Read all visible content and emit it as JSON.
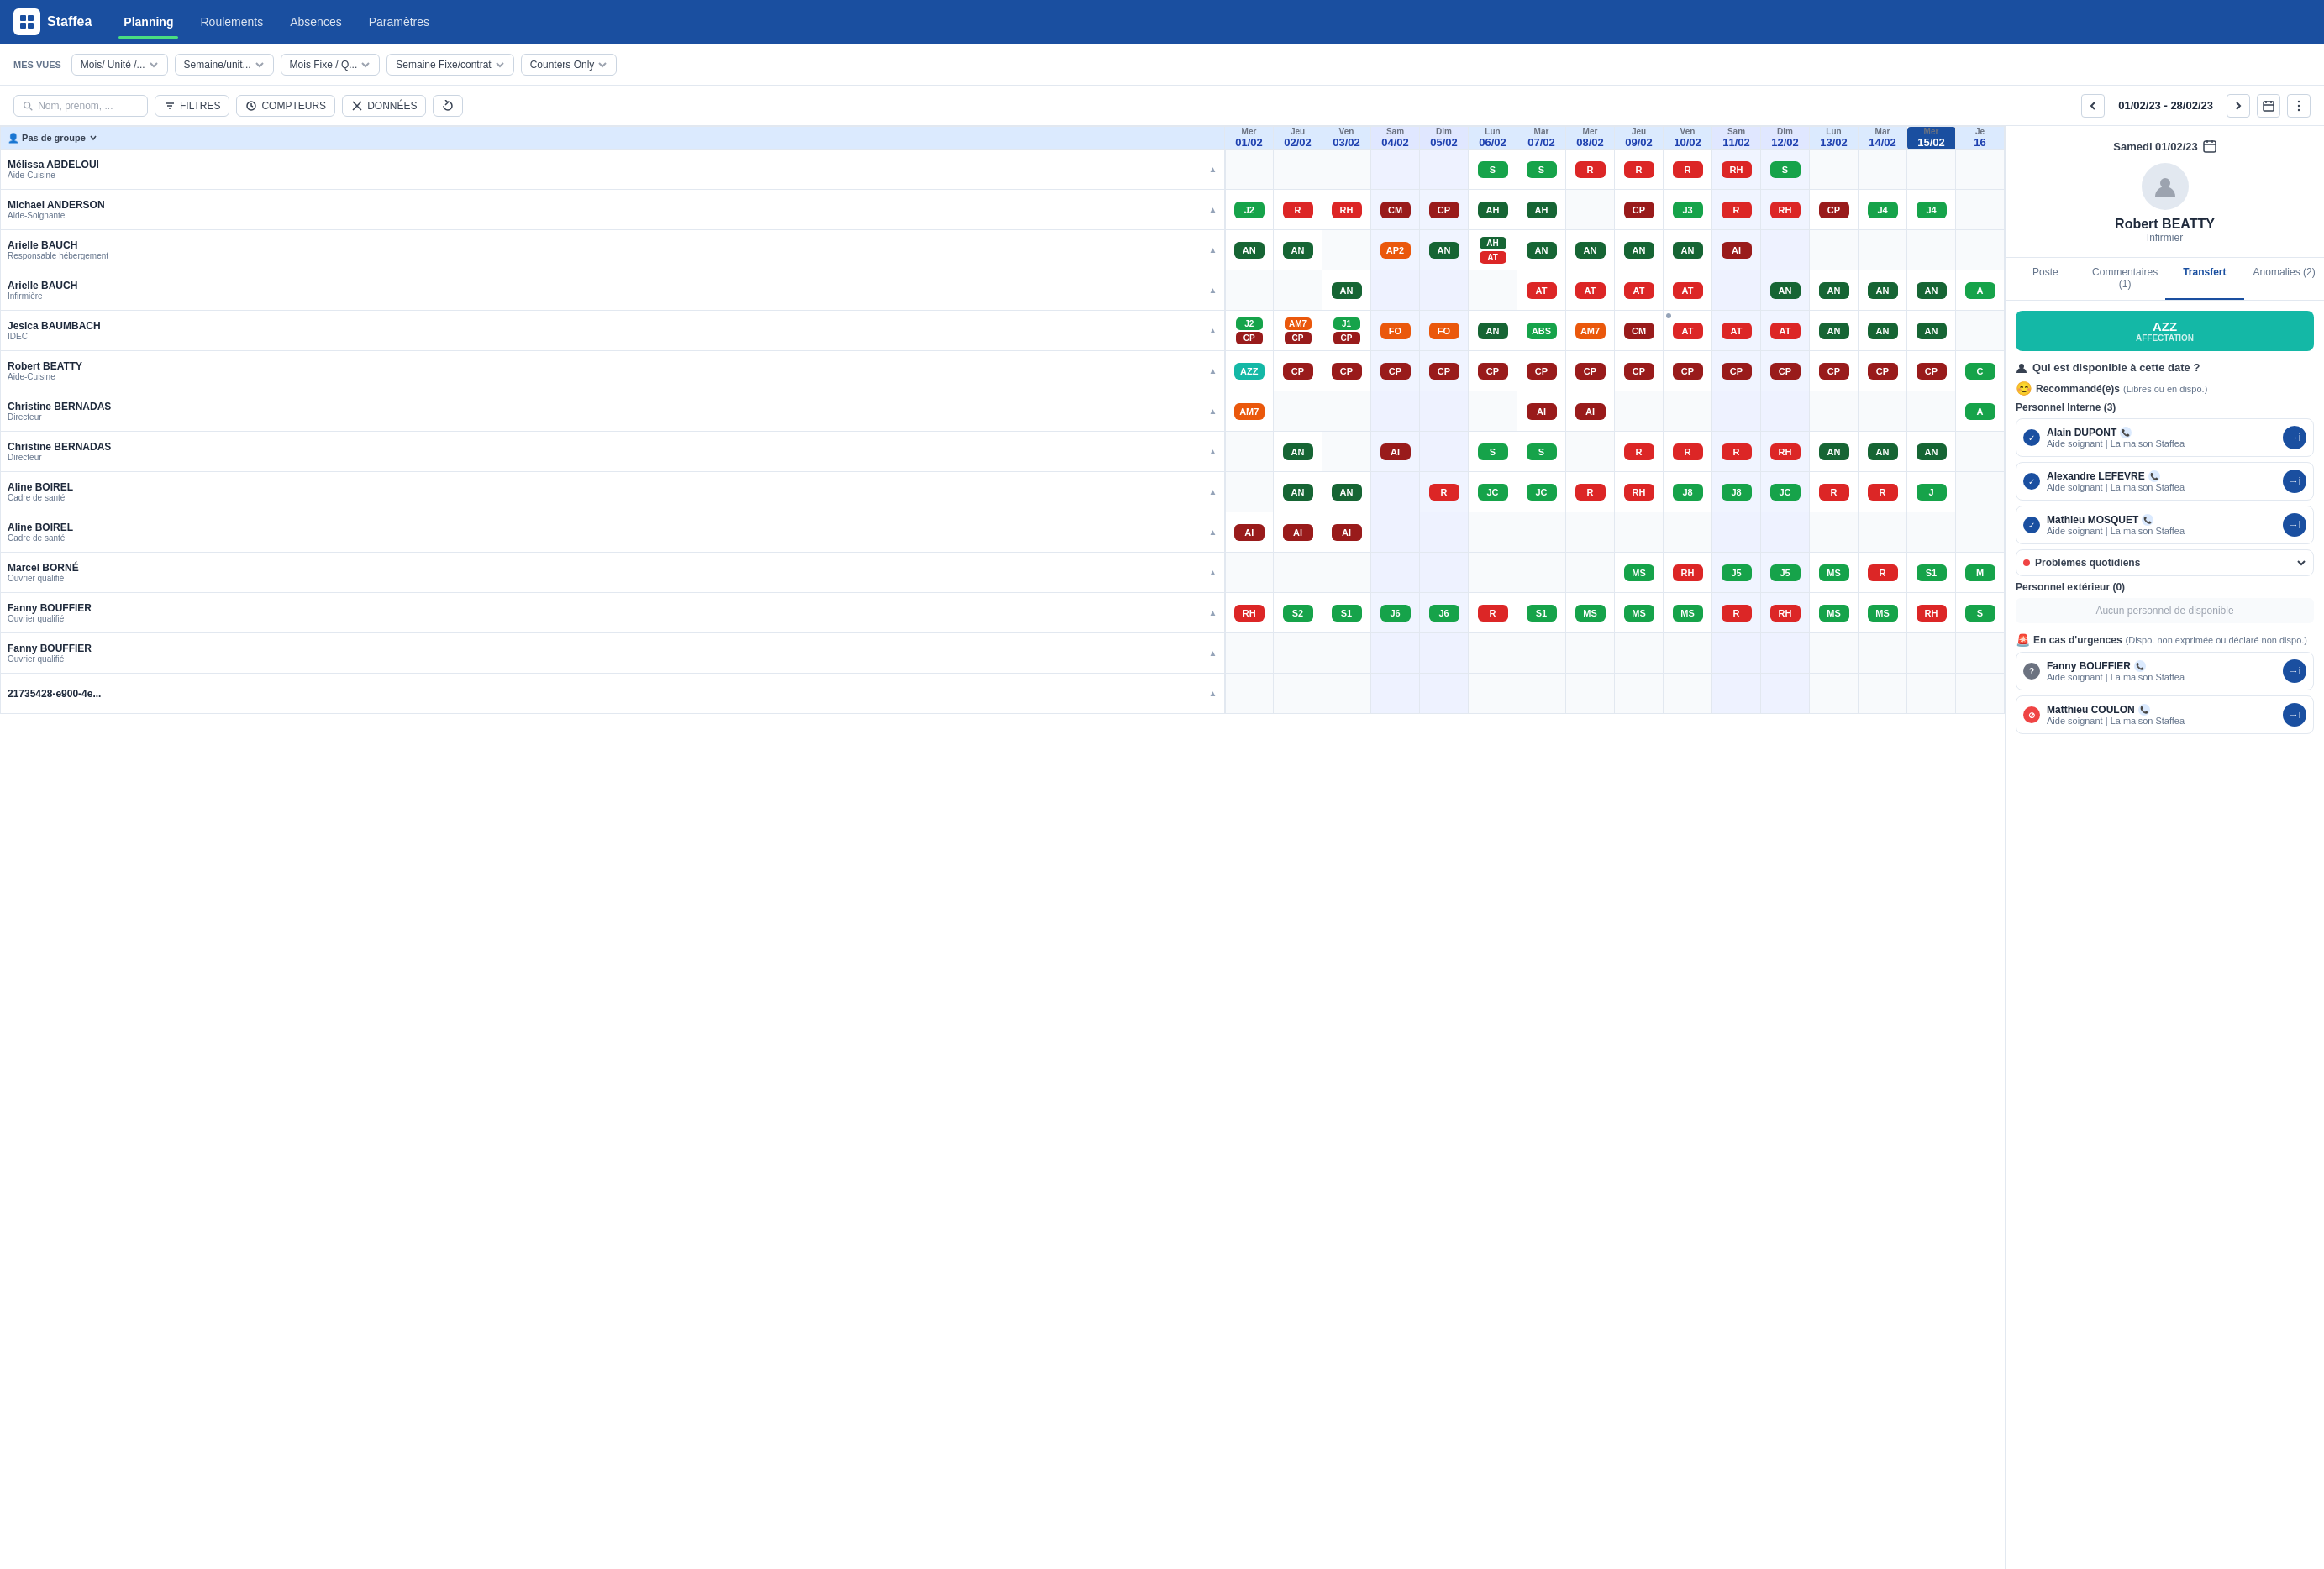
{
  "app": {
    "logo_text": "Staffea",
    "nav_items": [
      "Planning",
      "Roulements",
      "Absences",
      "Paramètres"
    ]
  },
  "views_bar": {
    "label": "MES VUES",
    "options": [
      {
        "label": "Mois/ Unité /...",
        "has_arrow": true
      },
      {
        "label": "Semaine/unit...",
        "has_arrow": true
      },
      {
        "label": "Mois Fixe / Q...",
        "has_arrow": true
      },
      {
        "label": "Semaine Fixe/contrat",
        "has_arrow": true
      },
      {
        "label": "Counters Only",
        "has_arrow": true
      }
    ]
  },
  "toolbar": {
    "search_placeholder": "Nom, prénom, ...",
    "filters_label": "FILTRES",
    "compteurs_label": "COMPTEURS",
    "donnees_label": "DONNÉES",
    "date_range": "01/02/23 - 28/02/23"
  },
  "grid": {
    "group_label": "Pas de groupe",
    "columns": [
      {
        "day": "Mer",
        "num": "01/02"
      },
      {
        "day": "Jeu",
        "num": "02/02"
      },
      {
        "day": "Ven",
        "num": "03/02"
      },
      {
        "day": "Sam",
        "num": "04/02",
        "weekend": true
      },
      {
        "day": "Dim",
        "num": "05/02",
        "weekend": true
      },
      {
        "day": "Lun",
        "num": "06/02"
      },
      {
        "day": "Mar",
        "num": "07/02"
      },
      {
        "day": "Mer",
        "num": "08/02"
      },
      {
        "day": "Jeu",
        "num": "09/02"
      },
      {
        "day": "Ven",
        "num": "10/02"
      },
      {
        "day": "Sam",
        "num": "11/02",
        "weekend": true
      },
      {
        "day": "Dim",
        "num": "12/02",
        "weekend": true
      },
      {
        "day": "Lun",
        "num": "13/02"
      },
      {
        "day": "Mar",
        "num": "14/02"
      },
      {
        "day": "Mer",
        "num": "15/02",
        "today": true
      },
      {
        "day": "Je",
        "num": "16"
      }
    ],
    "employees": [
      {
        "name": "Mélissa ABDELOUI",
        "role": "Aide-Cuisine",
        "shifts": [
          "",
          "",
          "",
          "",
          "",
          "S",
          "S",
          "R",
          "R",
          "R",
          "RH",
          "S",
          "",
          "",
          "",
          ""
        ]
      },
      {
        "name": "Michael ANDERSON",
        "role": "Aide-Soignante",
        "shifts": [
          "J2",
          "R",
          "RH",
          "CM",
          "CP",
          "AH",
          "AH",
          "",
          "CP",
          "J3",
          "R",
          "RH",
          "CP",
          "J4",
          "J4",
          ""
        ]
      },
      {
        "name": "Arielle BAUCH",
        "role": "Responsable hébergement",
        "shifts": [
          "AN",
          "AN",
          "",
          "AP2",
          "AN",
          "AH+AT",
          "AN",
          "AN",
          "AN",
          "AN",
          "AI",
          "",
          "",
          "",
          "",
          ""
        ]
      },
      {
        "name": "Arielle BAUCH",
        "role": "Infirmière",
        "shifts": [
          "",
          "",
          "AN",
          "",
          "",
          "",
          "AT",
          "AT",
          "AT",
          "AT",
          "",
          "AN",
          "AN",
          "AN",
          "AN",
          "A"
        ]
      },
      {
        "name": "Jesica BAUMBACH",
        "role": "IDEC",
        "shifts": [
          "J2+CP",
          "AM7+CP",
          "J1+CP",
          "FO",
          "FO",
          "AN",
          "ABS",
          "AM7",
          "CM",
          "AT",
          "AT",
          "AT",
          "AN",
          "AN",
          "AN",
          ""
        ]
      },
      {
        "name": "Robert BEATTY",
        "role": "Aide-Cuisine",
        "shifts": [
          "AZZ",
          "CP",
          "CP",
          "CP",
          "CP",
          "CP",
          "CP",
          "CP",
          "CP",
          "CP",
          "CP",
          "CP",
          "CP",
          "CP",
          "CP",
          "C"
        ]
      },
      {
        "name": "Christine BERNADAS",
        "role": "Directeur",
        "shifts": [
          "AM7",
          "",
          "",
          "",
          "",
          "",
          "AI",
          "AI",
          "",
          "",
          "",
          "",
          "",
          "",
          "",
          "A"
        ]
      },
      {
        "name": "Christine BERNADAS",
        "role": "Directeur",
        "shifts": [
          "",
          "AN",
          "",
          "AI",
          "",
          "S",
          "S",
          "",
          "R",
          "R",
          "R",
          "RH",
          "AN",
          "AN",
          "AN",
          ""
        ]
      },
      {
        "name": "Aline BOIREL",
        "role": "Cadre de santé",
        "shifts": [
          "",
          "AN",
          "AN",
          "",
          "R",
          "JC",
          "JC",
          "R",
          "RH",
          "J8",
          "J8",
          "JC",
          "R",
          "R",
          "J",
          ""
        ]
      },
      {
        "name": "Aline BOIREL",
        "role": "Cadre de santé",
        "shifts": [
          "AI",
          "AI",
          "AI",
          "",
          "",
          "",
          "",
          "",
          "",
          "",
          "",
          "",
          "",
          "",
          "",
          ""
        ]
      },
      {
        "name": "Marcel BORNÉ",
        "role": "Ouvrier qualifié",
        "shifts": [
          "",
          "",
          "",
          "",
          "",
          "",
          "",
          "",
          "MS",
          "RH",
          "J5",
          "J5",
          "MS",
          "R",
          "S1",
          "M"
        ]
      },
      {
        "name": "Fanny BOUFFIER",
        "role": "Ouvrier qualifié",
        "shifts": [
          "RH",
          "S2",
          "S1",
          "J6",
          "J6",
          "R",
          "S1",
          "MS",
          "MS",
          "MS",
          "R",
          "RH",
          "MS",
          "MS",
          "RH",
          "S"
        ]
      },
      {
        "name": "Fanny BOUFFIER",
        "role": "Ouvrier qualifié",
        "shifts": [
          "",
          "",
          "",
          "",
          "",
          "",
          "",
          "",
          "",
          "",
          "",
          "",
          "",
          "",
          "",
          ""
        ]
      },
      {
        "name": "21735428-e900-4e...",
        "role": "",
        "shifts": [
          "",
          "",
          "",
          "",
          "",
          "",
          "",
          "",
          "",
          "",
          "",
          "",
          "",
          "",
          "",
          ""
        ]
      }
    ]
  },
  "right_panel": {
    "date": "Samedi 01/02/23",
    "person_name": "Robert BEATTY",
    "person_role": "Infirmier",
    "tabs": [
      "Poste",
      "Commentaires (1)",
      "Transfert",
      "Anomalies (2)"
    ],
    "active_tab": "Transfert",
    "affectation": {
      "code": "AZZ",
      "label": "AFFECTATION"
    },
    "availability_title": "Qui est disponible à cette date ?",
    "recommended_label": "Recommandé(e)s",
    "recommended_sub": "(Libres ou en dispo.)",
    "internal_label": "Personnel Interne (3)",
    "internal_persons": [
      {
        "name": "Alain DUPONT",
        "role": "Aide soignant | La maison Staffea"
      },
      {
        "name": "Alexandre LEFEVRE",
        "role": "Aide soignant | La maison Staffea"
      },
      {
        "name": "Mathieu MOSQUET",
        "role": "Aide soignant | La maison Staffea"
      }
    ],
    "problems_label": "Problèmes quotidiens",
    "external_label": "Personnel extérieur (0)",
    "external_empty": "Aucun personnel de disponible",
    "urgent_label": "En cas d'urgences",
    "urgent_sub": "(Dispo. non exprimée ou déclaré non dispo.)",
    "urgent_persons": [
      {
        "name": "Fanny BOUFFIER",
        "role": "Aide soignant | La maison Staffea",
        "type": "question"
      },
      {
        "name": "Matthieu COULON",
        "role": "Aide soignant | La maison Staffea",
        "type": "no"
      }
    ]
  }
}
